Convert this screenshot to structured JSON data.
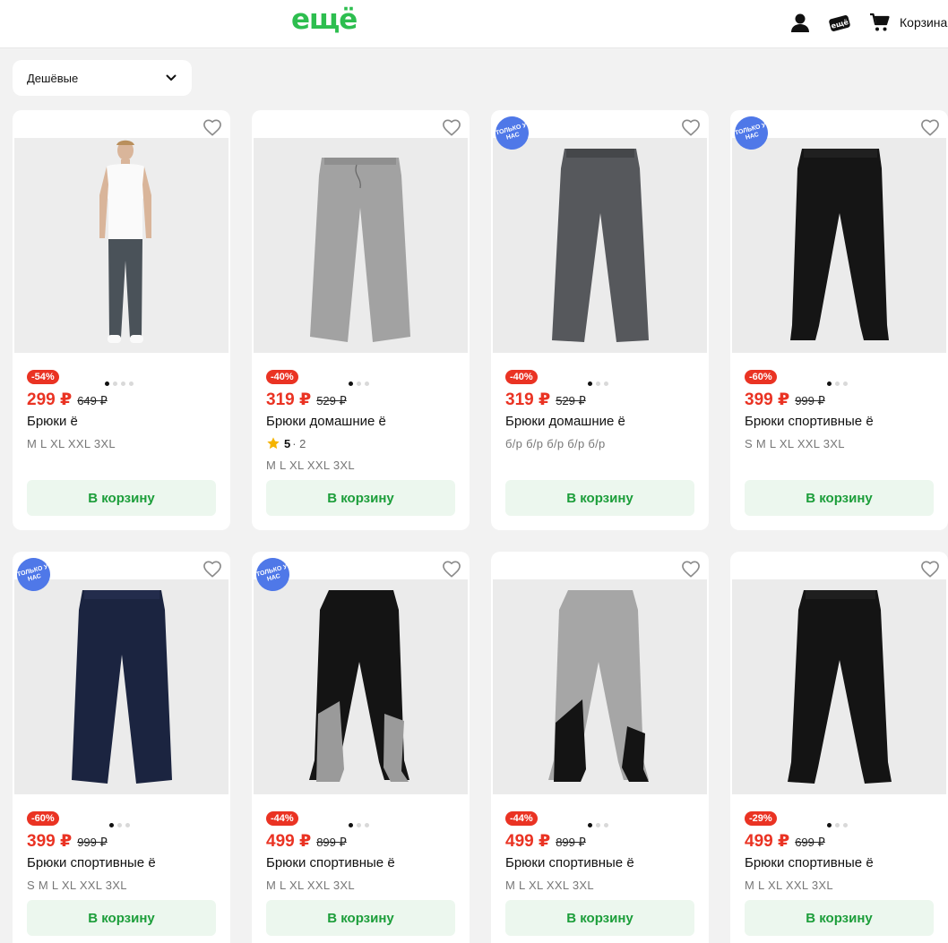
{
  "header": {
    "logo": "ещё",
    "profile_icon": "user-icon",
    "promo_icon": "promo-icon",
    "cart_icon": "cart-icon",
    "cart_label": "Корзина"
  },
  "sort": {
    "selected": "Дешёвые",
    "icon": "chevron-down-icon"
  },
  "colors": {
    "brand": "#2dbe4f",
    "sale": "#ea3323",
    "badge": "#4f78e8",
    "button_bg": "#ecf7ee",
    "button_text": "#1c9e3a"
  },
  "products": [
    {
      "discount": "-54%",
      "price": "299 ₽",
      "old_price": "649 ₽",
      "title": "Брюки ё",
      "sizes": "M L XL XXL 3XL",
      "button": "В корзину",
      "only_badge": "",
      "rating_score": "",
      "rating_count": "",
      "dots": 4,
      "active_dot": 0,
      "image": "model"
    },
    {
      "discount": "-40%",
      "price": "319 ₽",
      "old_price": "529 ₽",
      "title": "Брюки домашние ё",
      "sizes": "M L XL XXL 3XL",
      "button": "В корзину",
      "only_badge": "",
      "rating_score": "5",
      "rating_count": "· 2",
      "dots": 3,
      "active_dot": 0,
      "image": "gray"
    },
    {
      "discount": "-40%",
      "price": "319 ₽",
      "old_price": "529 ₽",
      "title": "Брюки домашние ё",
      "sizes": "б/р б/р б/р б/р б/р",
      "button": "В корзину",
      "only_badge": "ТОЛЬКО У НАС",
      "rating_score": "",
      "rating_count": "",
      "dots": 3,
      "active_dot": 0,
      "image": "darkgray"
    },
    {
      "discount": "-60%",
      "price": "399 ₽",
      "old_price": "999 ₽",
      "title": "Брюки спортивные ё",
      "sizes": "S M L XL XXL 3XL",
      "button": "В корзину",
      "only_badge": "ТОЛЬКО У НАС",
      "rating_score": "",
      "rating_count": "",
      "dots": 3,
      "active_dot": 0,
      "image": "black-jogger"
    },
    {
      "discount": "-60%",
      "price": "399 ₽",
      "old_price": "999 ₽",
      "title": "Брюки спортивные ё",
      "sizes": "S M L XL XXL 3XL",
      "button": "В корзину",
      "only_badge": "ТОЛЬКО У НАС",
      "rating_score": "",
      "rating_count": "",
      "dots": 3,
      "active_dot": 0,
      "image": "navy"
    },
    {
      "discount": "-44%",
      "price": "499 ₽",
      "old_price": "899 ₽",
      "title": "Брюки спортивные ё",
      "sizes": "M L XL XXL 3XL",
      "button": "В корзину",
      "only_badge": "ТОЛЬКО У НАС",
      "rating_score": "",
      "rating_count": "",
      "dots": 3,
      "active_dot": 0,
      "image": "black-gray-panel"
    },
    {
      "discount": "-44%",
      "price": "499 ₽",
      "old_price": "899 ₽",
      "title": "Брюки спортивные ё",
      "sizes": "M L XL XXL 3XL",
      "button": "В корзину",
      "only_badge": "",
      "rating_score": "",
      "rating_count": "",
      "dots": 3,
      "active_dot": 0,
      "image": "gray-black-panel"
    },
    {
      "discount": "-29%",
      "price": "499 ₽",
      "old_price": "699 ₽",
      "title": "Брюки спортивные ё",
      "sizes": "M L XL XXL 3XL",
      "button": "В корзину",
      "only_badge": "",
      "rating_score": "",
      "rating_count": "",
      "dots": 3,
      "active_dot": 0,
      "image": "black-jogger-2"
    }
  ]
}
